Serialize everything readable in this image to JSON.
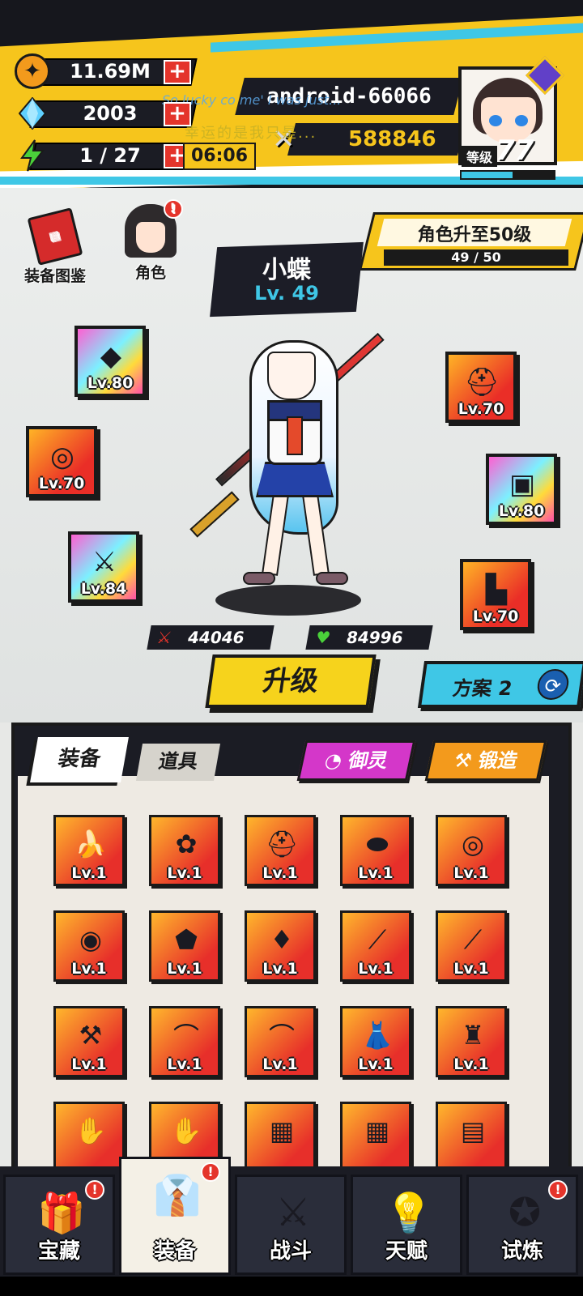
{
  "resources": {
    "coins": "11.69M",
    "gems": "2003",
    "energy": "1 / 27",
    "energy_timer": "06:06",
    "plus": "+"
  },
  "player": {
    "name": "android-66066",
    "power": "588846",
    "level_label": "等级",
    "level": "77",
    "xp_fraction": 0.55
  },
  "overlay": {
    "english": "So lucky co me' I was just...",
    "chinese": "幸运的是我只是..."
  },
  "shortcuts": {
    "book_label": "装备图鉴",
    "role_label": "角色",
    "badge": "!"
  },
  "quest": {
    "title": "角色升至50级",
    "progress": "49 / 50",
    "fraction": 0.98
  },
  "character": {
    "name": "小蝶",
    "level": "Lv. 49"
  },
  "equipped": [
    {
      "name": "necklace",
      "icon": "necklace-icon",
      "glyph": "◆",
      "level": "Lv.80",
      "rare": true
    },
    {
      "name": "ring",
      "icon": "ring-icon",
      "glyph": "◎",
      "level": "Lv.70",
      "rare": false
    },
    {
      "name": "weapon",
      "icon": "blade-icon",
      "glyph": "⚔",
      "level": "Lv.84",
      "rare": true
    },
    {
      "name": "helmet",
      "icon": "helmet-icon",
      "glyph": "⛑",
      "level": "Lv.70",
      "rare": false
    },
    {
      "name": "armor",
      "icon": "armor-icon",
      "glyph": "▣",
      "level": "Lv.80",
      "rare": true
    },
    {
      "name": "boots",
      "icon": "boots-icon",
      "glyph": "▙",
      "level": "Lv.70",
      "rare": false
    }
  ],
  "stats": {
    "attack": "44046",
    "hp": "84996"
  },
  "buttons": {
    "upgrade": "升级",
    "plan": "方案 2"
  },
  "inventory_tabs": {
    "equip": "装备",
    "items": "道具",
    "spirit": "御灵",
    "forge": "锻造"
  },
  "inventory": [
    {
      "icon": "banana-blade-icon",
      "glyph": "🍌",
      "level": "Lv.1"
    },
    {
      "icon": "scarf-icon",
      "glyph": "✿",
      "level": "Lv.1"
    },
    {
      "icon": "helmet-icon",
      "glyph": "⛑",
      "level": "Lv.1"
    },
    {
      "icon": "hat-icon",
      "glyph": "⬬",
      "level": "Lv.1"
    },
    {
      "icon": "ring-icon",
      "glyph": "◎",
      "level": "Lv.1"
    },
    {
      "icon": "orb-ring-icon",
      "glyph": "◉",
      "level": "Lv.1"
    },
    {
      "icon": "amulet-icon",
      "glyph": "⬟",
      "level": "Lv.1"
    },
    {
      "icon": "pendant-icon",
      "glyph": "♦",
      "level": "Lv.1"
    },
    {
      "icon": "ice-blade-icon",
      "glyph": "⟋",
      "level": "Lv.1"
    },
    {
      "icon": "red-blade-icon",
      "glyph": "⟋",
      "level": "Lv.1"
    },
    {
      "icon": "axe-icon",
      "glyph": "⚒",
      "level": "Lv.1"
    },
    {
      "icon": "scimitar-icon",
      "glyph": "⌒",
      "level": "Lv.1"
    },
    {
      "icon": "scimitar-icon",
      "glyph": "⌒",
      "level": "Lv.1"
    },
    {
      "icon": "white-dress-icon",
      "glyph": "👗",
      "level": "Lv.1"
    },
    {
      "icon": "dark-armor-icon",
      "glyph": "♜",
      "level": "Lv.1"
    },
    {
      "icon": "blue-glove-icon",
      "glyph": "✋",
      "level": ""
    },
    {
      "icon": "blue-glove-icon",
      "glyph": "✋",
      "level": ""
    },
    {
      "icon": "vest-icon",
      "glyph": "▦",
      "level": ""
    },
    {
      "icon": "vest-icon",
      "glyph": "▦",
      "level": ""
    },
    {
      "icon": "robe-icon",
      "glyph": "▤",
      "level": ""
    }
  ],
  "nav": [
    {
      "name": "treasure",
      "label": "宝藏",
      "icon": "treasure-chest-icon",
      "glyph": "🎁",
      "badge": true,
      "active": false
    },
    {
      "name": "equipment",
      "label": "装备",
      "icon": "uniform-icon",
      "glyph": "👔",
      "badge": true,
      "active": true
    },
    {
      "name": "battle",
      "label": "战斗",
      "icon": "swords-icon",
      "glyph": "⚔",
      "badge": false,
      "active": false
    },
    {
      "name": "talent",
      "label": "天赋",
      "icon": "lightbulb-icon",
      "glyph": "💡",
      "badge": false,
      "active": false
    },
    {
      "name": "trial",
      "label": "试炼",
      "icon": "emblem-icon",
      "glyph": "✪",
      "badge": true,
      "active": false
    }
  ],
  "colors": {
    "accent_yellow": "#f6c51c",
    "accent_cyan": "#3fc7e6",
    "danger_red": "#e4342b",
    "dark": "#1b1c24"
  }
}
